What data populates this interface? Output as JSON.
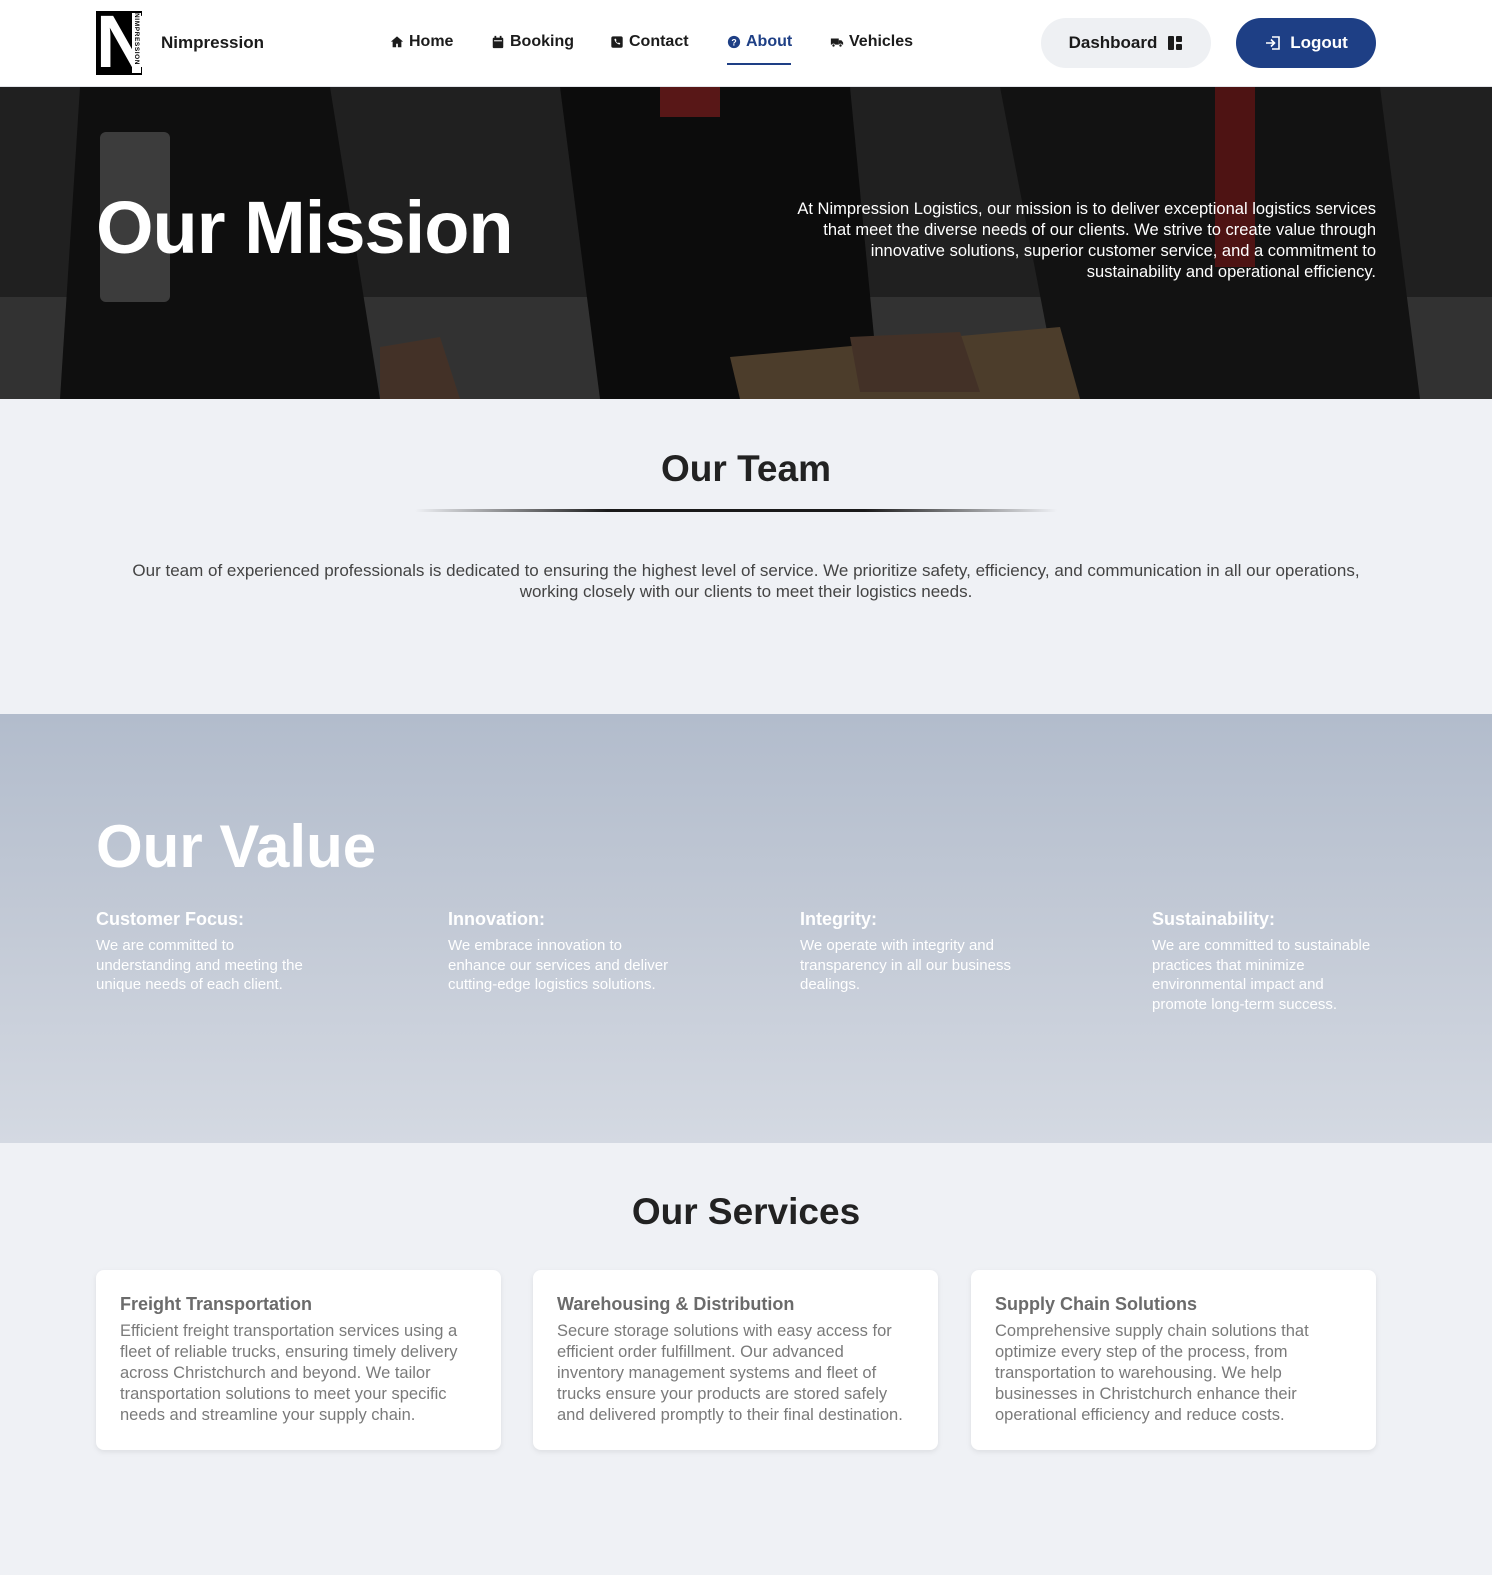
{
  "brand": {
    "name": "Nimpression",
    "logo_letter": "N",
    "logo_vertical_text": "NIMPRESSION"
  },
  "nav": {
    "items": [
      {
        "label": "Home",
        "icon": "home-icon"
      },
      {
        "label": "Booking",
        "icon": "calendar-icon"
      },
      {
        "label": "Contact",
        "icon": "phone-icon"
      },
      {
        "label": "About",
        "icon": "question-circle-icon",
        "active": true
      },
      {
        "label": "Vehicles",
        "icon": "truck-icon"
      }
    ]
  },
  "actions": {
    "dashboard_label": "Dashboard",
    "logout_label": "Logout"
  },
  "hero": {
    "title": "Our Mission",
    "text": "At Nimpression Logistics, our mission is to deliver exceptional logistics services that meet the diverse needs of our clients. We strive to create value through innovative solutions, superior customer service, and a commitment to sustainability and operational efficiency."
  },
  "team": {
    "title": "Our Team",
    "text": "Our team of experienced professionals is dedicated to ensuring the highest level of service. We prioritize safety, efficiency, and communication in all our operations, working closely with our clients to meet their logistics needs."
  },
  "values": {
    "title": "Our Value",
    "items": [
      {
        "title": "Customer Focus:",
        "text": "We are committed to understanding and meeting the unique needs of each client."
      },
      {
        "title": "Innovation:",
        "text": "We embrace innovation to enhance our services and deliver cutting-edge logistics solutions."
      },
      {
        "title": "Integrity:",
        "text": "We operate with integrity and transparency in all our business dealings."
      },
      {
        "title": "Sustainability:",
        "text": "We are committed to sustainable practices that minimize environmental impact and promote long-term success."
      }
    ]
  },
  "services": {
    "title": "Our Services",
    "items": [
      {
        "title": "Freight Transportation",
        "text": "Efficient freight transportation services using a fleet of reliable trucks, ensuring timely delivery across Christchurch and beyond. We tailor transportation solutions to meet your specific needs and streamline your supply chain."
      },
      {
        "title": "Warehousing & Distribution",
        "text": "Secure storage solutions with easy access for efficient order fulfillment. Our advanced inventory management systems and fleet of trucks ensure your products are stored safely and delivered promptly to their final destination."
      },
      {
        "title": "Supply Chain Solutions",
        "text": "Comprehensive supply chain solutions that optimize every step of the process, from transportation to warehousing. We help businesses in Christchurch enhance their operational efficiency and reduce costs."
      }
    ]
  },
  "colors": {
    "primary": "#1e3f85",
    "header_bg": "#ffffff",
    "page_bg": "#eff1f5"
  }
}
